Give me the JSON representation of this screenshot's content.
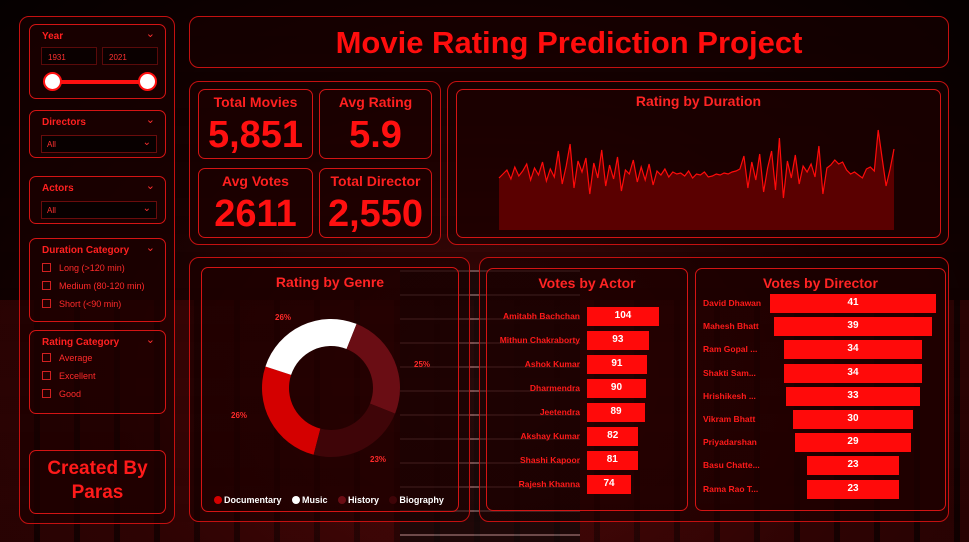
{
  "title": "Movie Rating Prediction Project",
  "credit": "Created By Paras",
  "colors": {
    "accent": "#ff1010",
    "background": "#000000",
    "donut": [
      "#d40000",
      "#ffffff",
      "#6a0d14",
      "#3f0508"
    ]
  },
  "slicers": {
    "year": {
      "label": "Year",
      "from": "1931",
      "to": "2021",
      "range": [
        1931,
        2021
      ]
    },
    "directors": {
      "label": "Directors",
      "value": "All"
    },
    "actors": {
      "label": "Actors",
      "value": "All"
    },
    "duration": {
      "label": "Duration Category",
      "options": [
        "Long (>120 min)",
        "Medium (80-120 min)",
        "Short (<90 min)"
      ]
    },
    "rating": {
      "label": "Rating Category",
      "options": [
        "Average",
        "Excellent",
        "Good"
      ]
    }
  },
  "kpis": [
    {
      "label": "Total Movies",
      "value": "5,851"
    },
    {
      "label": "Avg Rating",
      "value": "5.9"
    },
    {
      "label": "Avg Votes",
      "value": "2611"
    },
    {
      "label": "Total Director",
      "value": "2,550"
    }
  ],
  "chart_data": [
    {
      "type": "area",
      "title": "Rating by Duration",
      "xlabel": "",
      "ylabel": "",
      "ylim": [
        0,
        10
      ],
      "values": [
        5.2,
        5.6,
        6.0,
        5.1,
        6.3,
        5.4,
        5.9,
        6.6,
        5.0,
        6.2,
        5.5,
        6.8,
        4.9,
        6.1,
        5.3,
        7.9,
        4.6,
        6.4,
        8.6,
        4.2,
        6.9,
        5.8,
        7.2,
        3.6,
        6.7,
        5.2,
        8.0,
        4.4,
        6.5,
        5.1,
        7.3,
        3.9,
        6.0,
        5.6,
        7.0,
        4.8,
        6.3,
        5.0,
        6.6,
        4.5,
        5.9,
        5.5,
        6.1,
        5.3,
        5.8,
        5.6,
        5.7,
        5.4,
        5.9,
        5.2,
        5.6,
        5.5,
        5.8,
        5.3,
        5.4,
        5.6,
        5.5,
        5.7,
        5.6,
        5.8,
        5.9,
        6.1,
        7.4,
        4.2,
        6.8,
        5.0,
        7.6,
        3.8,
        6.2,
        7.9,
        4.0,
        9.2,
        3.2,
        6.9,
        5.2,
        7.5,
        4.6,
        6.4,
        5.8,
        6.6,
        5.3,
        8.4,
        3.6,
        6.2,
        6.5,
        7.0,
        6.6,
        6.8,
        6.0,
        5.6,
        5.8,
        5.5,
        5.2,
        6.1,
        6.3,
        5.9,
        10.0,
        7.2,
        4.4,
        6.1,
        8.1
      ]
    },
    {
      "type": "pie",
      "title": "Rating by Genre",
      "categories": [
        "Documentary",
        "Music",
        "History",
        "Biography"
      ],
      "values": [
        26,
        26,
        25,
        23
      ],
      "data_labels": [
        "26%",
        "26%",
        "25%",
        "23%"
      ]
    },
    {
      "type": "bar",
      "title": "Votes by Actor",
      "categories": [
        "Amitabh Bachchan",
        "Mithun Chakraborty",
        "Ashok Kumar",
        "Dharmendra",
        "Jeetendra",
        "Akshay Kumar",
        "Shashi Kapoor",
        "Rajesh Khanna"
      ],
      "values": [
        104,
        93,
        91,
        90,
        89,
        82,
        81,
        74
      ]
    },
    {
      "type": "bar",
      "title": "Votes by Director",
      "categories": [
        "David Dhawan",
        "Mahesh Bhatt",
        "Ram Gopal ...",
        "Shakti Sam...",
        "Hrishikesh ...",
        "Vikram Bhatt",
        "Priyadarshan",
        "Basu Chatte...",
        "Rama Rao T..."
      ],
      "values": [
        41,
        39,
        34,
        34,
        33,
        30,
        29,
        23,
        23
      ]
    }
  ]
}
